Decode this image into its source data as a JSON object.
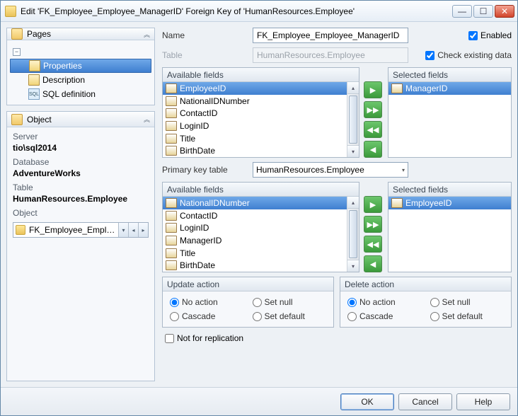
{
  "window": {
    "title": "Edit 'FK_Employee_Employee_ManagerID' Foreign Key of 'HumanResources.Employee'"
  },
  "pages": {
    "header": "Pages",
    "items": [
      "Properties",
      "Description",
      "SQL definition"
    ],
    "selected": 0
  },
  "object": {
    "header": "Object",
    "server_label": "Server",
    "server_value": "tio\\sql2014",
    "database_label": "Database",
    "database_value": "AdventureWorks",
    "table_label": "Table",
    "table_value": "HumanResources.Employee",
    "object_label": "Object",
    "combo_text": "FK_Employee_Employee..."
  },
  "form": {
    "name_label": "Name",
    "name_value": "FK_Employee_Employee_ManagerID",
    "enabled_label": "Enabled",
    "enabled_value": true,
    "table_label": "Table",
    "table_value": "HumanResources.Employee",
    "check_existing_label": "Check existing data",
    "check_existing_value": true,
    "pk_table_label": "Primary key table",
    "pk_table_value": "HumanResources.Employee",
    "not_for_replication_label": "Not for replication",
    "not_for_replication_value": false
  },
  "fk_fields": {
    "available_header": "Available fields",
    "selected_header": "Selected fields",
    "available": [
      "EmployeeID",
      "NationalIDNumber",
      "ContactID",
      "LoginID",
      "Title",
      "BirthDate"
    ],
    "available_selected": 0,
    "selected": [
      "ManagerID"
    ]
  },
  "pk_fields": {
    "available_header": "Available fields",
    "selected_header": "Selected fields",
    "available": [
      "NationalIDNumber",
      "ContactID",
      "LoginID",
      "ManagerID",
      "Title",
      "BirthDate"
    ],
    "available_selected": 0,
    "selected": [
      "EmployeeID"
    ]
  },
  "update_action": {
    "header": "Update action",
    "options": [
      "No action",
      "Set null",
      "Cascade",
      "Set default"
    ],
    "selected": 0
  },
  "delete_action": {
    "header": "Delete action",
    "options": [
      "No action",
      "Set null",
      "Cascade",
      "Set default"
    ],
    "selected": 0
  },
  "buttons": {
    "ok": "OK",
    "cancel": "Cancel",
    "help": "Help"
  }
}
